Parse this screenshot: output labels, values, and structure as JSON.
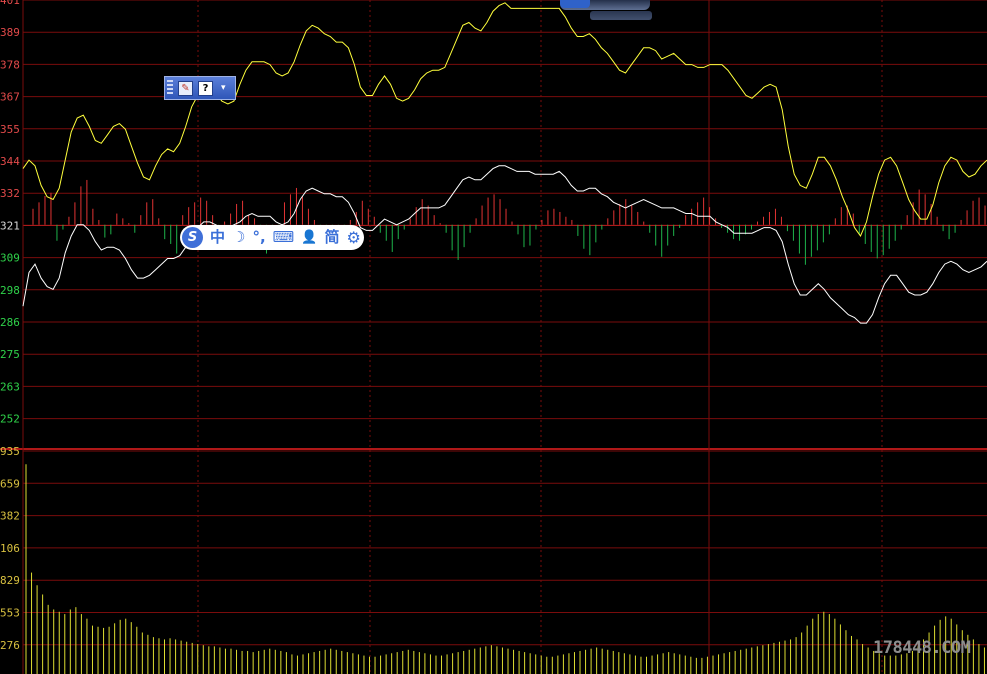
{
  "chart_data": [
    {
      "type": "line",
      "panel": "intraday-price",
      "y_ticks": [
        "401",
        "389",
        "378",
        "367",
        "355",
        "344",
        "332",
        "321",
        "309",
        "298",
        "286",
        "275",
        "263",
        "252"
      ],
      "ylim": [
        246,
        401
      ],
      "base": 321,
      "x": [
        0,
        1,
        2,
        3,
        4,
        5,
        6,
        7,
        8,
        9,
        10,
        11,
        12,
        13,
        14,
        15,
        16,
        17,
        18,
        19,
        20,
        21,
        22,
        23,
        24,
        25,
        26,
        27,
        28,
        29,
        30,
        31,
        32,
        33,
        34,
        35,
        36,
        37,
        38,
        39,
        40,
        41,
        42,
        43,
        44,
        45,
        46,
        47,
        48,
        49,
        50,
        51,
        52,
        53,
        54,
        55,
        56,
        57,
        58,
        59,
        60,
        61,
        62,
        63,
        64,
        65,
        66,
        67,
        68,
        69,
        70,
        71,
        72,
        73,
        74,
        75,
        76,
        77,
        78,
        79,
        80,
        81,
        82,
        83,
        84,
        85,
        86,
        87,
        88,
        89,
        90,
        91,
        92,
        93,
        94,
        95,
        96,
        97,
        98,
        99,
        100,
        101,
        102,
        103,
        104,
        105,
        106,
        107,
        108,
        109,
        110,
        111,
        112,
        113,
        114,
        115,
        116,
        117,
        118,
        119,
        120,
        121,
        122,
        123,
        124,
        125,
        126,
        127,
        128,
        129,
        130,
        131,
        132,
        133,
        134,
        135,
        136,
        137,
        138,
        139,
        140,
        141,
        142,
        143,
        144,
        145,
        146,
        147,
        148,
        149,
        150,
        151,
        152,
        153,
        154,
        155,
        156,
        157,
        158,
        159,
        160,
        161,
        162,
        163,
        164,
        165,
        166,
        167,
        168,
        169,
        170,
        171,
        172,
        173,
        174,
        175,
        176,
        177,
        178,
        179,
        180,
        181,
        182,
        183,
        184,
        185,
        186,
        187,
        188,
        189,
        190,
        191,
        192,
        193,
        194,
        195,
        196,
        197,
        198,
        199,
        200,
        201,
        202,
        203,
        204,
        205,
        206,
        207,
        208,
        209,
        210,
        211,
        212,
        213,
        214,
        215,
        216,
        217,
        218,
        219,
        220,
        221,
        222,
        223,
        224,
        225,
        226,
        227,
        228,
        229,
        230,
        231,
        232,
        233,
        234,
        235,
        236,
        237,
        238,
        239
      ],
      "series": [
        {
          "color": "#ffff3c",
          "values": [
            341,
            344,
            342,
            335,
            331,
            330,
            334,
            344,
            354,
            359,
            360,
            356,
            351,
            350,
            353,
            356,
            357,
            355,
            349,
            343,
            338,
            337,
            342,
            346,
            348,
            347,
            350,
            356,
            363,
            367,
            370,
            369,
            368,
            365,
            364,
            365,
            371,
            376,
            379,
            379,
            379,
            378,
            375,
            374,
            375,
            379,
            385,
            390,
            392,
            391,
            389,
            388,
            386,
            386,
            384,
            378,
            370,
            367,
            367,
            371,
            374,
            371,
            366,
            365,
            366,
            369,
            373,
            375,
            376,
            376,
            377,
            382,
            387,
            392,
            393,
            391,
            390,
            393,
            397,
            399,
            400,
            398,
            398,
            398,
            398,
            398,
            398,
            398,
            398,
            398,
            395,
            391,
            388,
            388,
            389,
            387,
            384,
            382,
            379,
            376,
            375,
            378,
            381,
            384,
            384,
            383,
            380,
            381,
            382,
            380,
            378,
            378,
            377,
            377,
            378,
            378,
            378,
            376,
            373,
            370,
            367,
            366,
            368,
            370,
            371,
            370,
            362,
            349,
            339,
            335,
            334,
            339,
            345,
            345,
            342,
            337,
            331,
            326,
            320,
            317,
            322,
            331,
            339,
            344,
            345,
            342,
            336,
            330,
            326,
            323,
            323,
            328,
            336,
            342,
            345,
            344,
            340,
            338,
            339,
            342,
            344
          ],
          "color_name": "price"
        },
        {
          "color": "#ffffff",
          "values": [
            292,
            304,
            307,
            302,
            299,
            298,
            302,
            311,
            317,
            321,
            321,
            319,
            315,
            312,
            313,
            313,
            312,
            309,
            305,
            302,
            302,
            303,
            305,
            307,
            309,
            309,
            310,
            313,
            317,
            320,
            322,
            322,
            321,
            320,
            320,
            321,
            322,
            324,
            325,
            324,
            324,
            324,
            322,
            321,
            322,
            325,
            330,
            333,
            334,
            333,
            332,
            332,
            331,
            331,
            329,
            325,
            320,
            319,
            319,
            321,
            323,
            322,
            321,
            322,
            323,
            325,
            327,
            327,
            327,
            327,
            328,
            331,
            334,
            337,
            338,
            337,
            337,
            339,
            341,
            342,
            342,
            341,
            340,
            340,
            340,
            339,
            339,
            339,
            339,
            340,
            338,
            335,
            333,
            333,
            334,
            334,
            332,
            331,
            329,
            328,
            327,
            328,
            329,
            330,
            329,
            328,
            327,
            327,
            327,
            326,
            325,
            325,
            324,
            324,
            324,
            322,
            321,
            320,
            318,
            318,
            318,
            318,
            319,
            320,
            320,
            319,
            315,
            307,
            300,
            296,
            296,
            298,
            300,
            298,
            295,
            293,
            291,
            289,
            288,
            286,
            286,
            289,
            295,
            300,
            303,
            303,
            300,
            297,
            296,
            296,
            297,
            300,
            304,
            307,
            308,
            307,
            305,
            304,
            305,
            306,
            308
          ],
          "color_name": "avg-price"
        }
      ]
    },
    {
      "type": "bar",
      "panel": "buy-sell-strength",
      "base": 321,
      "up_color": "#e23333",
      "down_color": "#1eb44b",
      "values": [
        10,
        14,
        18,
        20,
        -10,
        -3,
        5,
        14,
        24,
        28,
        10,
        3,
        -8,
        -6,
        7,
        4,
        1,
        -5,
        6,
        14,
        16,
        4,
        -9,
        -12,
        -18,
        6,
        11,
        14,
        17,
        15,
        6,
        -5,
        2,
        7,
        13,
        15,
        6,
        4,
        -10,
        -18,
        -10,
        -3,
        14,
        19,
        23,
        18,
        10,
        3,
        -4,
        -9,
        -12,
        -5,
        -3,
        3,
        8,
        15,
        10,
        5,
        -5,
        -10,
        -17,
        -9,
        -3,
        4,
        11,
        16,
        12,
        6,
        1,
        -5,
        -16,
        -22,
        -14,
        -5,
        4,
        12,
        17,
        19,
        16,
        10,
        2,
        -6,
        -14,
        -13,
        -3,
        3,
        9,
        10,
        8,
        5,
        3,
        -7,
        -15,
        -19,
        -11,
        -3,
        4,
        9,
        13,
        16,
        12,
        8,
        2,
        -5,
        -13,
        -20,
        -13,
        -7,
        -2,
        6,
        10,
        14,
        17,
        11,
        4,
        -2,
        -5,
        -9,
        -10,
        -6,
        -3,
        2,
        5,
        8,
        10,
        5,
        -4,
        -10,
        -18,
        -25,
        -20,
        -16,
        -11,
        -6,
        4,
        11,
        12,
        7,
        -6,
        -12,
        -17,
        -21,
        -19,
        -15,
        -10,
        -3,
        6,
        14,
        22,
        19,
        13,
        5,
        -4,
        -9,
        -5,
        3,
        9,
        15,
        17,
        12,
        5
      ],
      "bars_count": 161
    },
    {
      "type": "bar",
      "panel": "volume",
      "y_ticks": [
        "935",
        "659",
        "382",
        "106",
        "829",
        "553",
        "276"
      ],
      "ylim": [
        0,
        1935
      ],
      "color": "#dede32",
      "values": [
        1820,
        880,
        770,
        690,
        600,
        560,
        540,
        520,
        560,
        580,
        520,
        480,
        420,
        410,
        400,
        410,
        440,
        470,
        480,
        450,
        410,
        360,
        340,
        320,
        310,
        300,
        310,
        300,
        290,
        280,
        270,
        260,
        250,
        240,
        240,
        230,
        220,
        220,
        210,
        200,
        200,
        190,
        200,
        210,
        220,
        210,
        200,
        190,
        170,
        160,
        170,
        180,
        190,
        200,
        210,
        220,
        210,
        200,
        190,
        180,
        170,
        160,
        150,
        150,
        160,
        170,
        180,
        190,
        200,
        210,
        200,
        190,
        180,
        170,
        160,
        160,
        170,
        180,
        190,
        200,
        210,
        220,
        230,
        240,
        250,
        240,
        230,
        220,
        210,
        200,
        190,
        180,
        170,
        160,
        150,
        150,
        160,
        170,
        180,
        190,
        200,
        210,
        220,
        230,
        220,
        210,
        200,
        190,
        180,
        170,
        160,
        150,
        150,
        160,
        170,
        180,
        190,
        180,
        170,
        160,
        150,
        140,
        140,
        150,
        160,
        170,
        180,
        190,
        200,
        210,
        220,
        230,
        240,
        250,
        260,
        270,
        280,
        290,
        300,
        320,
        360,
        420,
        480,
        520,
        540,
        520,
        480,
        430,
        380,
        330,
        300,
        260,
        230,
        200,
        180,
        160,
        160,
        160,
        170,
        180,
        200,
        240,
        300,
        360,
        420,
        470,
        500,
        480,
        430,
        380,
        340,
        300,
        260,
        230
      ],
      "bars_count": 161
    }
  ],
  "ime_toolbar": {
    "logo": "S",
    "chinese": "中",
    "moon": "☽",
    "punct": "°,",
    "keyboard": "⌨",
    "user": "👤",
    "simplified": "简",
    "settings": "⚙"
  },
  "lang_bar": {
    "help": "?",
    "menu": "▾"
  },
  "watermark": "178448.COM"
}
